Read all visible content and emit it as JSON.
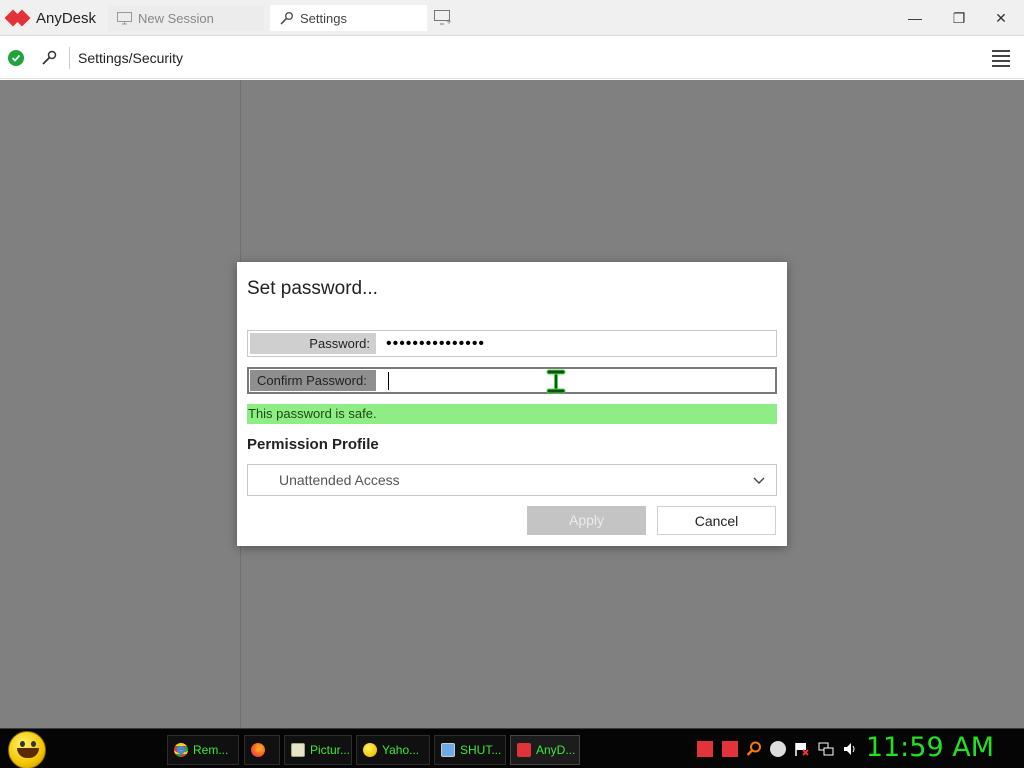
{
  "app": {
    "name": "AnyDesk",
    "tabs": [
      {
        "label": "New Session"
      },
      {
        "label": "Settings"
      }
    ]
  },
  "window_controls": {
    "minimize": "—",
    "restore": "❐",
    "close": "✕"
  },
  "address": {
    "path": "Settings/Security",
    "status": "connected"
  },
  "dialog": {
    "title": "Set password...",
    "password_label": "Password:",
    "password_value": "•••••••••••••••",
    "confirm_label": "Confirm Password:",
    "confirm_value": "",
    "safety_message": "This password is safe.",
    "permission_label": "Permission Profile",
    "permission_value": "Unattended Access",
    "apply_label": "Apply",
    "cancel_label": "Cancel"
  },
  "taskbar": {
    "items": [
      {
        "label": "Rem...",
        "icon": "chrome-icon"
      },
      {
        "label": "",
        "icon": "firefox-icon"
      },
      {
        "label": "Pictur...",
        "icon": "picture-icon"
      },
      {
        "label": "Yaho...",
        "icon": "yahoo-icon"
      },
      {
        "label": "SHUT...",
        "icon": "monitor-icon"
      },
      {
        "label": "AnyD...",
        "icon": "anydesk-icon"
      }
    ],
    "clock": "11:59 AM"
  },
  "colors": {
    "accent": "#e3333a",
    "safe_bg": "#8fed85",
    "clock": "#23e023",
    "overlay": "#808080"
  }
}
